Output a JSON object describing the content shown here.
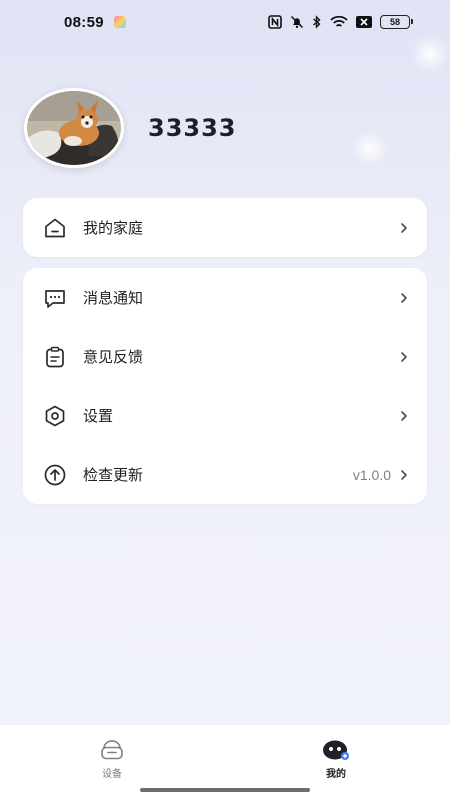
{
  "status_bar": {
    "time": "08:59",
    "battery": "58",
    "icons": [
      "app-notification-icon",
      "nfc-icon",
      "mute-icon",
      "bluetooth-icon",
      "wifi-icon",
      "sim-off-icon",
      "battery-icon"
    ]
  },
  "profile": {
    "username": "33333",
    "avatar": "corgi-dog-photo"
  },
  "menu_family": {
    "items": [
      {
        "icon": "home-icon",
        "label": "我的家庭"
      }
    ]
  },
  "menu_main": {
    "items": [
      {
        "icon": "message-icon",
        "label": "消息通知"
      },
      {
        "icon": "feedback-icon",
        "label": "意见反馈"
      },
      {
        "icon": "settings-icon",
        "label": "设置"
      },
      {
        "icon": "upload-icon",
        "label": "检查更新",
        "value": "v1.0.0"
      }
    ]
  },
  "tab_bar": {
    "tabs": [
      {
        "icon": "device-icon",
        "label": "设备",
        "active": false
      },
      {
        "icon": "robot-icon",
        "label": "我的",
        "active": true
      }
    ]
  },
  "colors": {
    "accent": "#3d7bff",
    "text": "#1e1f24",
    "muted": "#7b7f8c",
    "background": "#eef0f9"
  }
}
